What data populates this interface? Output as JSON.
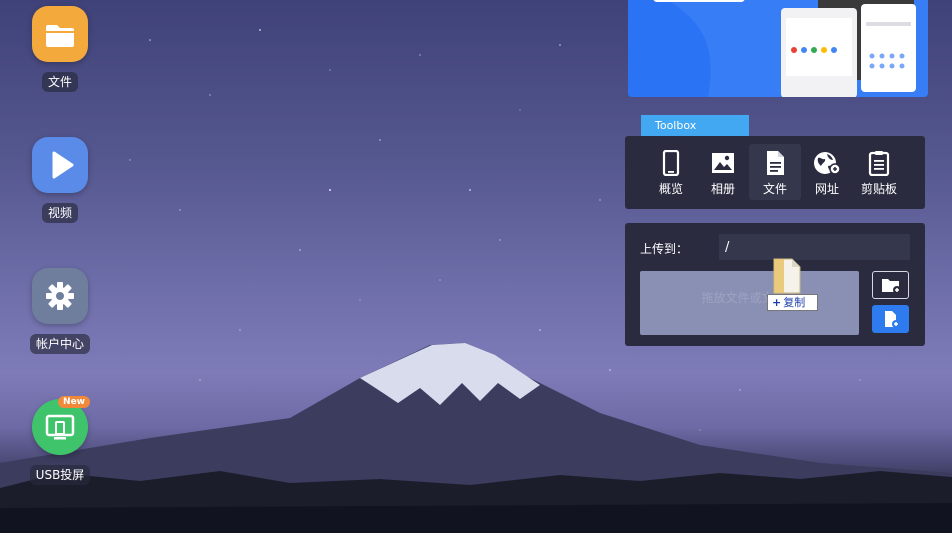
{
  "desktop": {
    "icons": [
      {
        "label": "文件",
        "icon": "folder-icon"
      },
      {
        "label": "视频",
        "icon": "play-icon"
      },
      {
        "label": "帐户中心",
        "icon": "gear-icon"
      },
      {
        "label": "USB投屏",
        "icon": "screen-cast-icon",
        "badge": "New"
      }
    ]
  },
  "toolbox": {
    "tab_label": "Toolbox",
    "tools": [
      {
        "label": "概览",
        "icon": "phone-icon"
      },
      {
        "label": "相册",
        "icon": "image-icon"
      },
      {
        "label": "文件",
        "icon": "document-icon",
        "active": true
      },
      {
        "label": "网址",
        "icon": "globe-icon"
      },
      {
        "label": "剪贴板",
        "icon": "clipboard-icon"
      }
    ]
  },
  "upload": {
    "label": "上传到：",
    "path": "/",
    "dropzone_text": "拖放文件或文件夹",
    "drag_tooltip": "复制"
  },
  "colors": {
    "accent": "#2e7bf0",
    "toolbox_tab": "#42a8f2",
    "panel_bg": "#2a2b3f"
  }
}
